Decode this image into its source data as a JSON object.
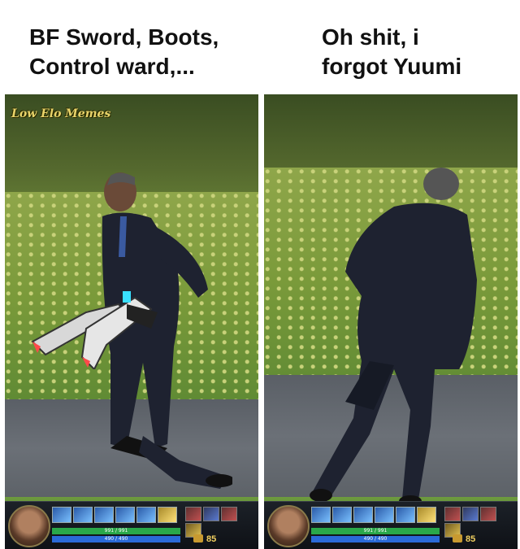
{
  "captions": {
    "left": "BF Sword, Boots,\nControl ward,...",
    "right": "Oh shit, i\nforgot Yuumi"
  },
  "watermark": "Low Elo Memes",
  "hud": {
    "hp_text": "991 / 991",
    "mana_text": "490 / 490",
    "gold": "85"
  },
  "icons": [
    "champion-portrait-icon",
    "skill-icon",
    "item-icon",
    "gold-icon",
    "blade-item-icon"
  ],
  "colors": {
    "caption": "#111111",
    "hp": "#2aa84a",
    "mana": "#2a6ad8",
    "gold": "#f2d060"
  }
}
